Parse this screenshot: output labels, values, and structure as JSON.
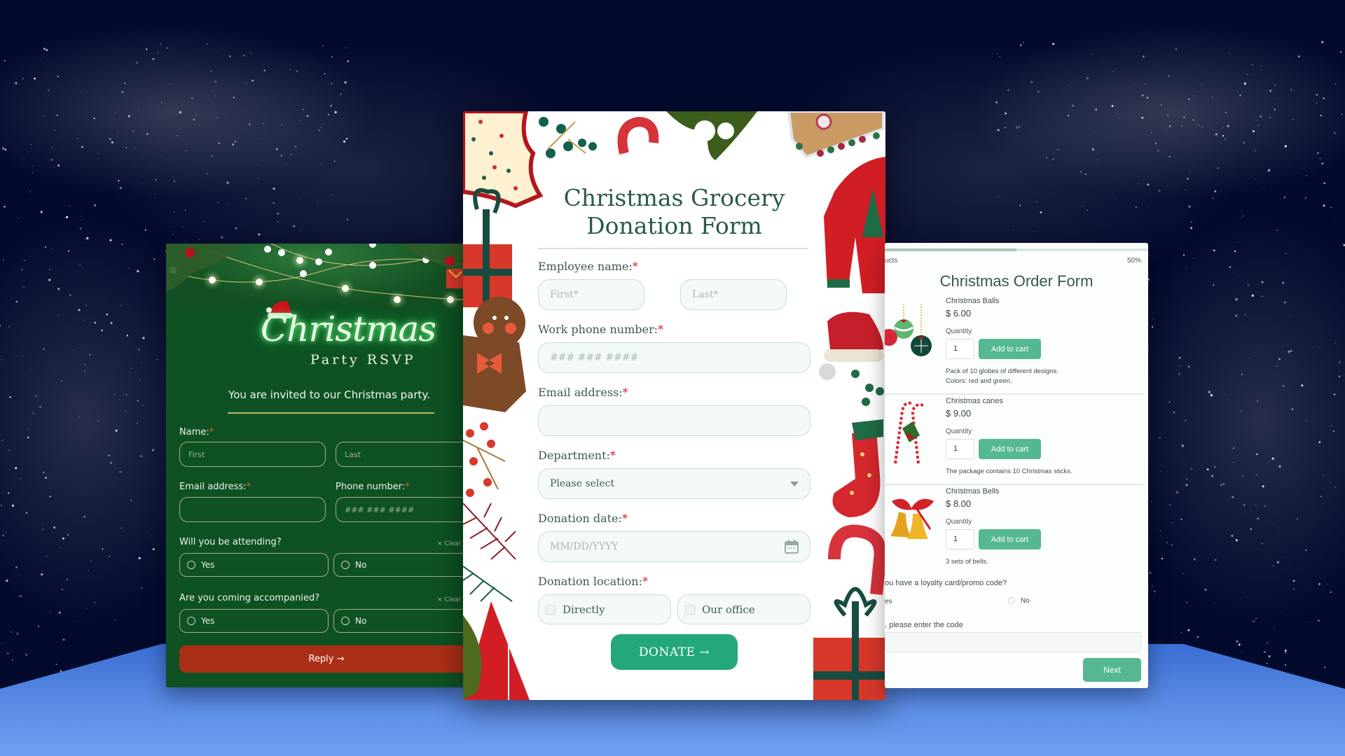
{
  "rsvp_form": {
    "title": "Christmas",
    "subtitle": "Party RSVP",
    "invite_text": "You are invited to our Christmas party.",
    "name_label": "Name:",
    "first_placeholder": "First",
    "last_placeholder": "Last",
    "email_label": "Email address:",
    "phone_label": "Phone number:",
    "phone_placeholder": "### ### ####",
    "attending_question": "Will you be attending?",
    "accompanied_question": "Are you coming accompanied?",
    "clear_label": "Clear",
    "yes_label": "Yes",
    "no_label": "No",
    "reply_button": "Reply →",
    "required_mark": "*",
    "colors": {
      "background": "#0e5224",
      "button": "#ab2f17"
    }
  },
  "donation_form": {
    "title_line1": "Christmas Grocery",
    "title_line2": "Donation Form",
    "employee_name_label": "Employee name:",
    "first_placeholder": "First*",
    "last_placeholder": "Last*",
    "phone_label": "Work phone number:",
    "phone_placeholder": "### ### ####",
    "email_label": "Email address:",
    "department_label": "Department:",
    "department_selected": "Please select",
    "date_label": "Donation date:",
    "date_placeholder": "MM/DD/YYYY",
    "location_label": "Donation location:",
    "location_options": [
      "Directly",
      "Our office"
    ],
    "donate_button": "DONATE →",
    "required_mark": "*",
    "colors": {
      "accent": "#24a87a",
      "title": "#2b5a4d"
    }
  },
  "order_form": {
    "step_label": "ucts",
    "progress_percent": 50,
    "progress_text": "50%",
    "title": "Christmas Order Form",
    "quantity_label": "Quantity",
    "add_button": "Add to cart",
    "products": [
      {
        "name": "Christmas Balls",
        "price": "$ 6.00",
        "quantity": "1",
        "description": [
          "Pack of 10 globes of different designs.",
          "Colors: red and green."
        ]
      },
      {
        "name": "Christmas canes",
        "price": "$ 9.00",
        "quantity": "1",
        "description": [
          "The package contains 10 Christmas sticks."
        ]
      },
      {
        "name": "Christmas Bells",
        "price": "$ 8.00",
        "quantity": "1",
        "description": [
          "3 sets of bells."
        ]
      }
    ],
    "loyalty_question": "ou have a loyalty card/promo code?",
    "loyalty_yes": "es",
    "loyalty_no": "No",
    "code_label": ", please enter the code",
    "next_button": "Next",
    "colors": {
      "accent": "#55b891"
    }
  }
}
